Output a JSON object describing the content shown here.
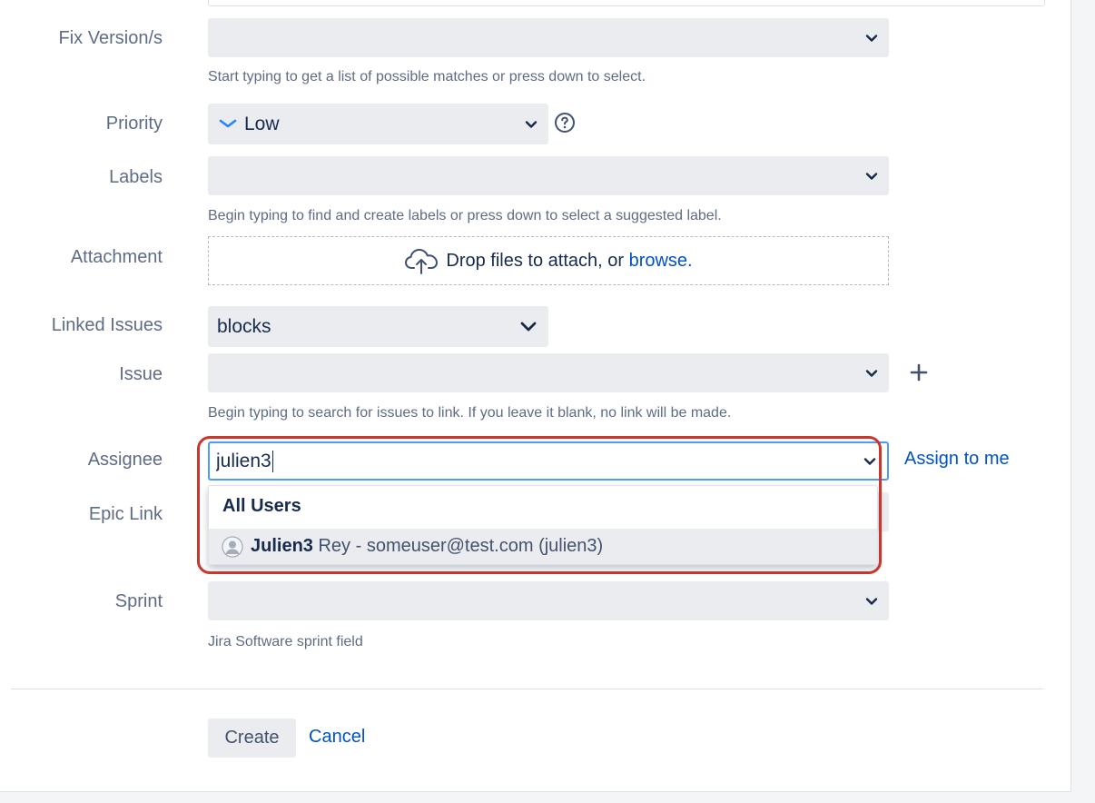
{
  "form": {
    "fix_versions": {
      "label": "Fix Version/s",
      "value": "",
      "hint": "Start typing to get a list of possible matches or press down to select."
    },
    "priority": {
      "label": "Priority",
      "value": "Low",
      "priority_icon": "chevron-down-priority-low-icon",
      "help_icon": "question-circle-icon"
    },
    "labels": {
      "label": "Labels",
      "value": "",
      "hint": "Begin typing to find and create labels or press down to select a suggested label."
    },
    "attachment": {
      "label": "Attachment",
      "drop_text": "Drop files to attach, or ",
      "browse_text": "browse.",
      "icon": "cloud-upload-icon"
    },
    "linked_issues": {
      "label": "Linked Issues",
      "value": "blocks"
    },
    "issue": {
      "label": "Issue",
      "value": "",
      "hint": "Begin typing to search for issues to link. If you leave it blank, no link will be made.",
      "add_icon": "plus-icon"
    },
    "assignee": {
      "label": "Assignee",
      "value": "julien3",
      "assign_to_me": "Assign to me",
      "dropdown": {
        "heading": "All Users",
        "items": [
          {
            "match": "Julien3",
            "rest": " Rey - someuser@test.com (julien3)",
            "avatar_icon": "user-avatar-icon"
          }
        ]
      }
    },
    "epic_link": {
      "label": "Epic Link"
    },
    "sprint": {
      "label": "Sprint",
      "value": "",
      "hint": "Jira Software sprint field"
    }
  },
  "actions": {
    "create_label": "Create",
    "cancel_label": "Cancel"
  },
  "colors": {
    "link": "#0052cc",
    "select_bg": "#ebecf0",
    "focus_border": "#4c9aff",
    "annotation_ring": "#c9372c",
    "priority_low": "#2684ff"
  }
}
